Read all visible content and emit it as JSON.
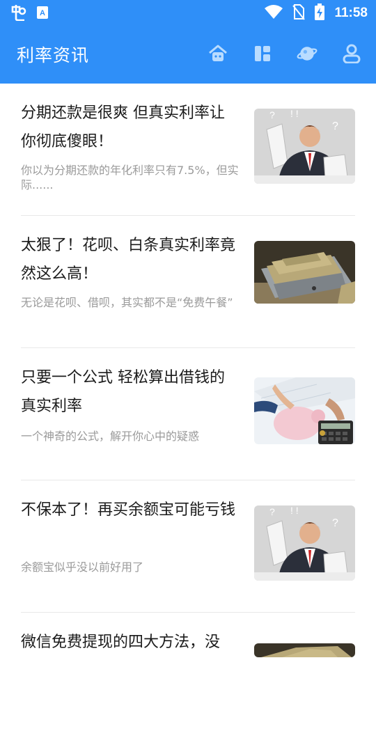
{
  "status_bar": {
    "time": "11:58",
    "icons": [
      "app-logo-icon",
      "a-icon",
      "wifi-icon",
      "no-sim-icon",
      "battery-charging-icon"
    ]
  },
  "app_bar": {
    "title": "利率资讯",
    "actions": [
      {
        "name": "home-icon",
        "label": ""
      },
      {
        "name": "layout-icon",
        "label": ""
      },
      {
        "name": "planet-icon",
        "label": ""
      },
      {
        "name": "user-icon",
        "label": ""
      }
    ]
  },
  "articles": [
    {
      "title": "分期还款是很爽 但真实利率让你彻底傻眼！",
      "desc": "你以为分期还款的年化利率只有7.5%，但实际......",
      "thumb": "confused-businessman-image"
    },
    {
      "title": "太狠了！花呗、白条真实利率竟然这么高！",
      "desc": "无论是花呗、借呗，其实都不是“免费午餐”",
      "thumb": "cash-box-image"
    },
    {
      "title": "只要一个公式 轻松算出借钱的真实利率",
      "desc": "一个神奇的公式，解开你心中的疑惑",
      "thumb": "piggy-bank-calculator-image"
    },
    {
      "title": "不保本了！再买余额宝可能亏钱",
      "desc": "余额宝似乎没以前好用了",
      "thumb": "confused-businessman-image"
    },
    {
      "title": "微信免费提现的四大方法，没",
      "desc": "",
      "thumb": "cash-box-image"
    }
  ],
  "colors": {
    "primary": "#2f8ff8",
    "title_text": "#1b1b1b",
    "desc_text": "#9a9a9a"
  }
}
